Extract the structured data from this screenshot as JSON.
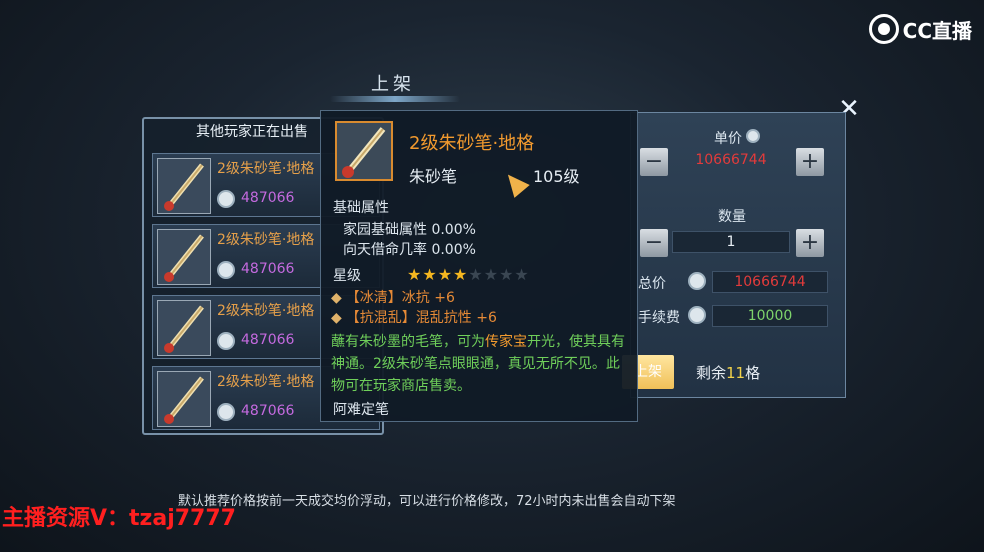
{
  "logo": {
    "text": "CC直播"
  },
  "dialog": {
    "title": "上架",
    "close_icon": "close-icon"
  },
  "listing_panel": {
    "header": "其他玩家正在出售",
    "rows": [
      {
        "name": "2级朱砂笔·地格",
        "price": "487066"
      },
      {
        "name": "2级朱砂笔·地格",
        "price": "487066"
      },
      {
        "name": "2级朱砂笔·地格",
        "price": "487066"
      },
      {
        "name": "2级朱砂笔·地格",
        "price": "487066"
      }
    ]
  },
  "sell_panel": {
    "unit_price_label": "单价",
    "unit_price_value": "10666744",
    "quantity_label": "数量",
    "quantity_value": "1",
    "total_label": "总价",
    "total_value": "10666744",
    "fee_label": "手续费",
    "fee_value": "10000",
    "shelf_button": "上架",
    "remaining_prefix": "剩余",
    "remaining_count": "11",
    "remaining_suffix": "格"
  },
  "tooltip": {
    "item_name": "2级朱砂笔·地格",
    "item_type": "朱砂笔",
    "item_level": "105级",
    "base_attr_title": "基础属性",
    "base_attr_1": "家园基础属性 0.00%",
    "base_attr_2": "向天借命几率 0.00%",
    "star_label": "星级",
    "stars_filled": 4,
    "stars_total": 8,
    "attr_1_tag": "【冰清】",
    "attr_1_text": "冰抗 +6",
    "attr_2_tag": "【抗混乱】",
    "attr_2_text": "混乱抗性 +6",
    "desc_a": "蘸有朱砂墨的毛笔，可为",
    "desc_hl": "传家宝",
    "desc_b": "开光，使其具有神通。2级朱砂笔点眼眼通，真见无所不见。此物可在玩家商店售卖。",
    "footer": "阿难定笔"
  },
  "notice": "默认推荐价格按前一天成交均价浮动，可以进行价格修改，72小时内未出售会自动下架",
  "streamer_overlay": "主播资源V：tzaj7777",
  "colors": {
    "accent_orange": "#f29a2e",
    "price_red": "#e23b3b",
    "fee_green": "#7ed46b",
    "price_purple": "#c46adf"
  }
}
